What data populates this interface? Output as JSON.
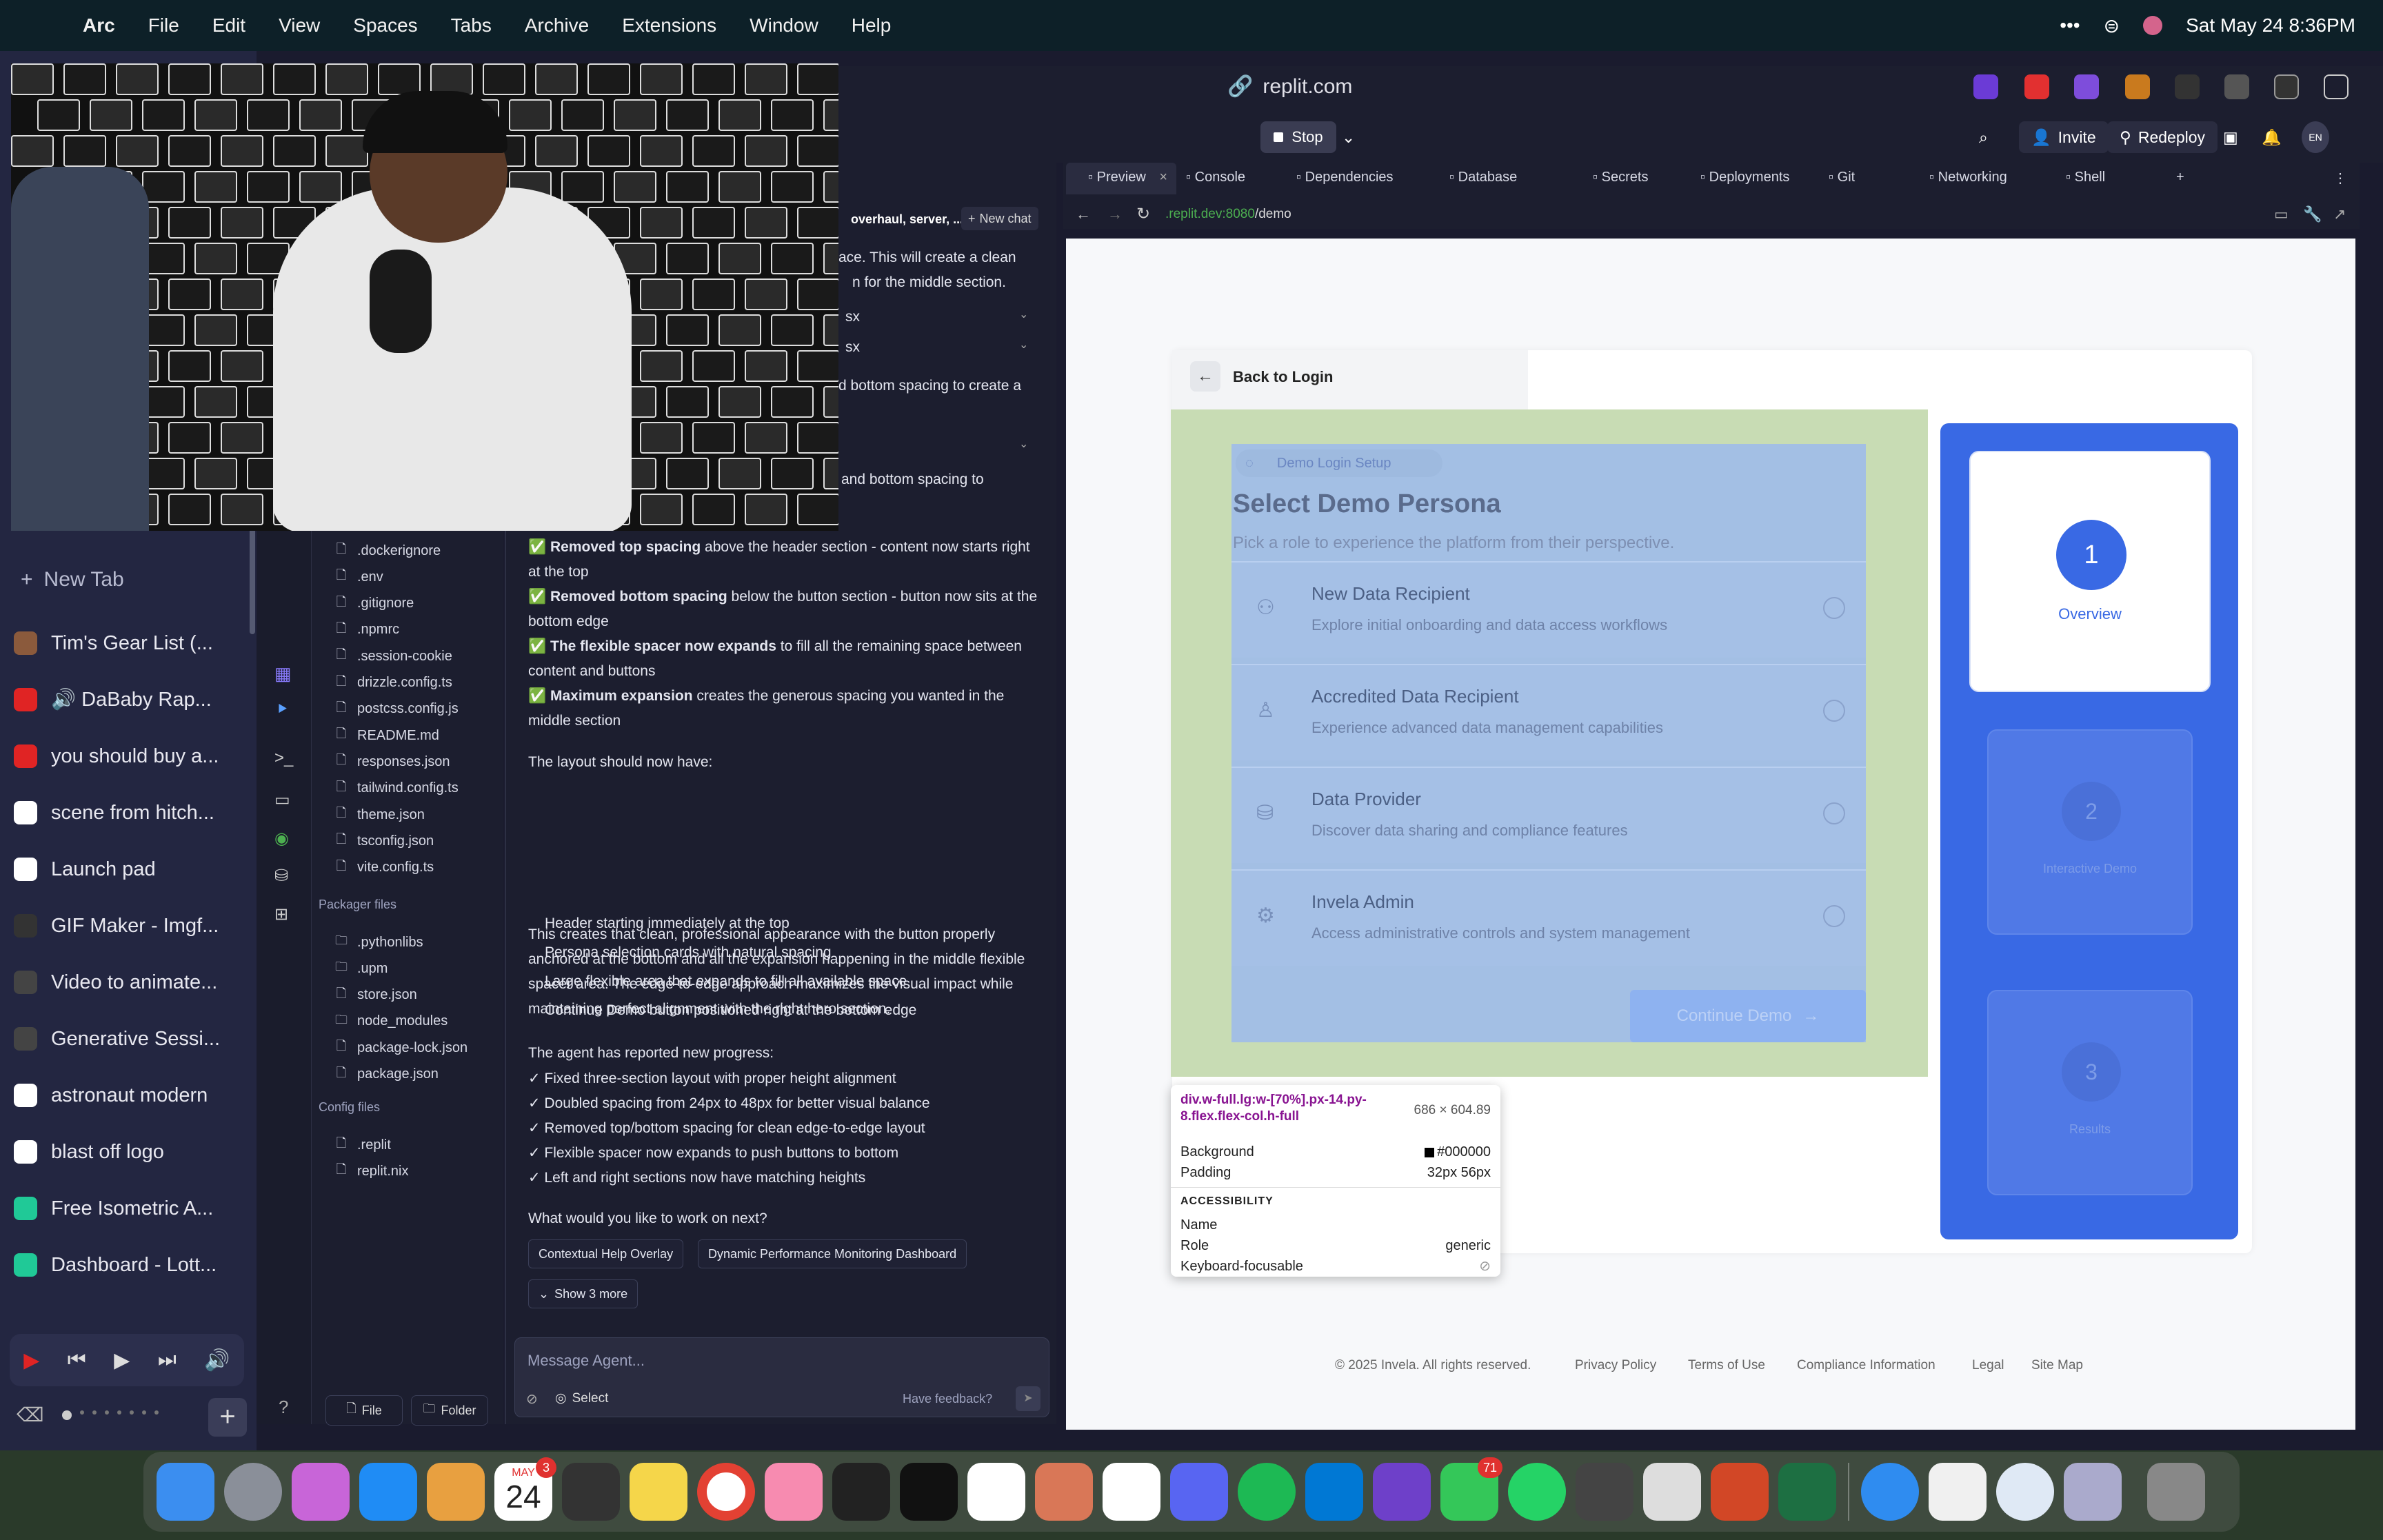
{
  "menubar": {
    "app": "Arc",
    "items": [
      "File",
      "Edit",
      "View",
      "Spaces",
      "Tabs",
      "Archive",
      "Extensions",
      "Window",
      "Help"
    ],
    "clock": "Sat May 24  8:36PM"
  },
  "sidebar": {
    "new_tab": "New Tab",
    "tabs": [
      {
        "label": "Tim's Gear List (...",
        "color": "#8b5a3c"
      },
      {
        "label": "🔊 DaBaby Rap...",
        "color": "#e02424"
      },
      {
        "label": "you should buy a...",
        "color": "#e02424"
      },
      {
        "label": "scene from hitch...",
        "color": "#ffffff"
      },
      {
        "label": "Launch pad",
        "color": "#ffffff"
      },
      {
        "label": "GIF Maker - Imgf...",
        "color": "#333"
      },
      {
        "label": "Video to animate...",
        "color": "#444"
      },
      {
        "label": "Generative Sessi...",
        "color": "#444"
      },
      {
        "label": "astronaut modern",
        "color": "#ffffff"
      },
      {
        "label": "blast off logo",
        "color": "#ffffff"
      },
      {
        "label": "Free Isometric A...",
        "color": "#20c997"
      },
      {
        "label": "Dashboard - Lott...",
        "color": "#20c997"
      }
    ]
  },
  "replit": {
    "url": "replit.com",
    "stop": "Stop",
    "invite": "Invite",
    "redeploy": "Redeploy",
    "avatar": "EN"
  },
  "files": {
    "items": [
      ".dockerignore",
      ".env",
      ".gitignore",
      ".npmrc",
      ".session-cookie",
      "drizzle.config.ts",
      "postcss.config.js",
      "README.md",
      "responses.json",
      "tailwind.config.ts",
      "theme.json",
      "tsconfig.json",
      "vite.config.ts"
    ],
    "packager_title": "Packager files",
    "packager": [
      ".pythonlibs",
      ".upm",
      "store.json",
      "node_modules",
      "package-lock.json",
      "package.json"
    ],
    "config_title": "Config files",
    "config": [
      ".replit",
      "replit.nix"
    ],
    "file_btn": "File",
    "folder_btn": "Folder"
  },
  "chat": {
    "header": "overhaul, server, ...",
    "new_chat": "New chat",
    "line1": "ace. This will create a clean",
    "line2": "n for the middle section.",
    "sx1": "sx",
    "sx2": "sx",
    "line3": "d bottom spacing to create a",
    "line4": "and bottom spacing to",
    "b1_bold": "Removed top spacing",
    "b1_rest": " above the header section - content now starts right at the top",
    "b2_bold": "Removed bottom spacing",
    "b2_rest": " below the button section - button now sits at the bottom edge",
    "b3_bold": "The flexible spacer now expands",
    "b3_rest": " to fill all the remaining space between content and buttons",
    "b4_bold": "Maximum expansion",
    "b4_rest": " creates the generous spacing you wanted in the middle section",
    "layout_intro": "The layout should now have:",
    "bullets": [
      "Header starting immediately at the top",
      "Persona selection cards with natural spacing",
      "Large flexible area that expands to fill all available space",
      "Continue Demo button positioned right at the bottom edge"
    ],
    "para": "This creates that clean, professional appearance with the button properly anchored at the bottom and all the expansion happening in the middle flexible spacer area. The edge-to-edge approach maximizes the visual impact while maintaining perfect alignment with the right hero section.",
    "progress_title": "The agent has reported new progress:",
    "progress": [
      "✓ Fixed three-section layout with proper height alignment",
      "✓ Doubled spacing from 24px to 48px for better visual balance",
      "✓ Removed top/bottom spacing for clean edge-to-edge layout",
      "✓ Flexible spacer now expands to push buttons to bottom",
      "✓ Left and right sections now have matching heights"
    ],
    "question": "What would you like to work on next?",
    "chip1": "Contextual Help Overlay",
    "chip2": "Dynamic Performance Monitoring Dashboard",
    "show_more": "Show 3 more",
    "placeholder": "Message Agent...",
    "select": "Select",
    "feedback": "Have feedback?"
  },
  "tabs": [
    "Preview",
    "Console",
    "Dependencies",
    "Database",
    "Secrets",
    "Deployments",
    "Git",
    "Networking",
    "Shell"
  ],
  "address": {
    "host": ".replit.dev:8080",
    "path": "/demo"
  },
  "demo": {
    "back": "Back to Login",
    "badge": "Demo Login Setup",
    "title": "Select Demo Persona",
    "subtitle": "Pick a role to experience the platform from their perspective.",
    "personas": [
      {
        "title": "New Data Recipient",
        "desc": "Explore initial onboarding and data access workflows"
      },
      {
        "title": "Accredited Data Recipient",
        "desc": "Experience advanced data management capabilities"
      },
      {
        "title": "Data Provider",
        "desc": "Discover data sharing and compliance features"
      },
      {
        "title": "Invela Admin",
        "desc": "Access administrative controls and system management"
      }
    ],
    "continue": "Continue Demo",
    "steps": [
      {
        "n": "1",
        "label": "Overview"
      },
      {
        "n": "2",
        "label": "Interactive Demo"
      },
      {
        "n": "3",
        "label": "Results"
      }
    ]
  },
  "tooltip": {
    "selector": "div.w-full.lg:w-[70%].px-14.py-8.flex.flex-col.h-full",
    "size": "686 × 604.89",
    "bg_label": "Background",
    "bg_value": "#000000",
    "pad_label": "Padding",
    "pad_value": "32px 56px",
    "acc": "ACCESSIBILITY",
    "name": "Name",
    "role": "Role",
    "role_value": "generic",
    "kf": "Keyboard-focusable"
  },
  "footer": [
    "© 2025 Invela. All rights reserved.",
    "Privacy Policy",
    "Terms of Use",
    "Compliance Information",
    "Legal",
    "Site Map"
  ],
  "dock": {
    "calendar_month": "MAY",
    "calendar_day": "24",
    "calendar_badge": "3",
    "messages_badge": "71"
  }
}
